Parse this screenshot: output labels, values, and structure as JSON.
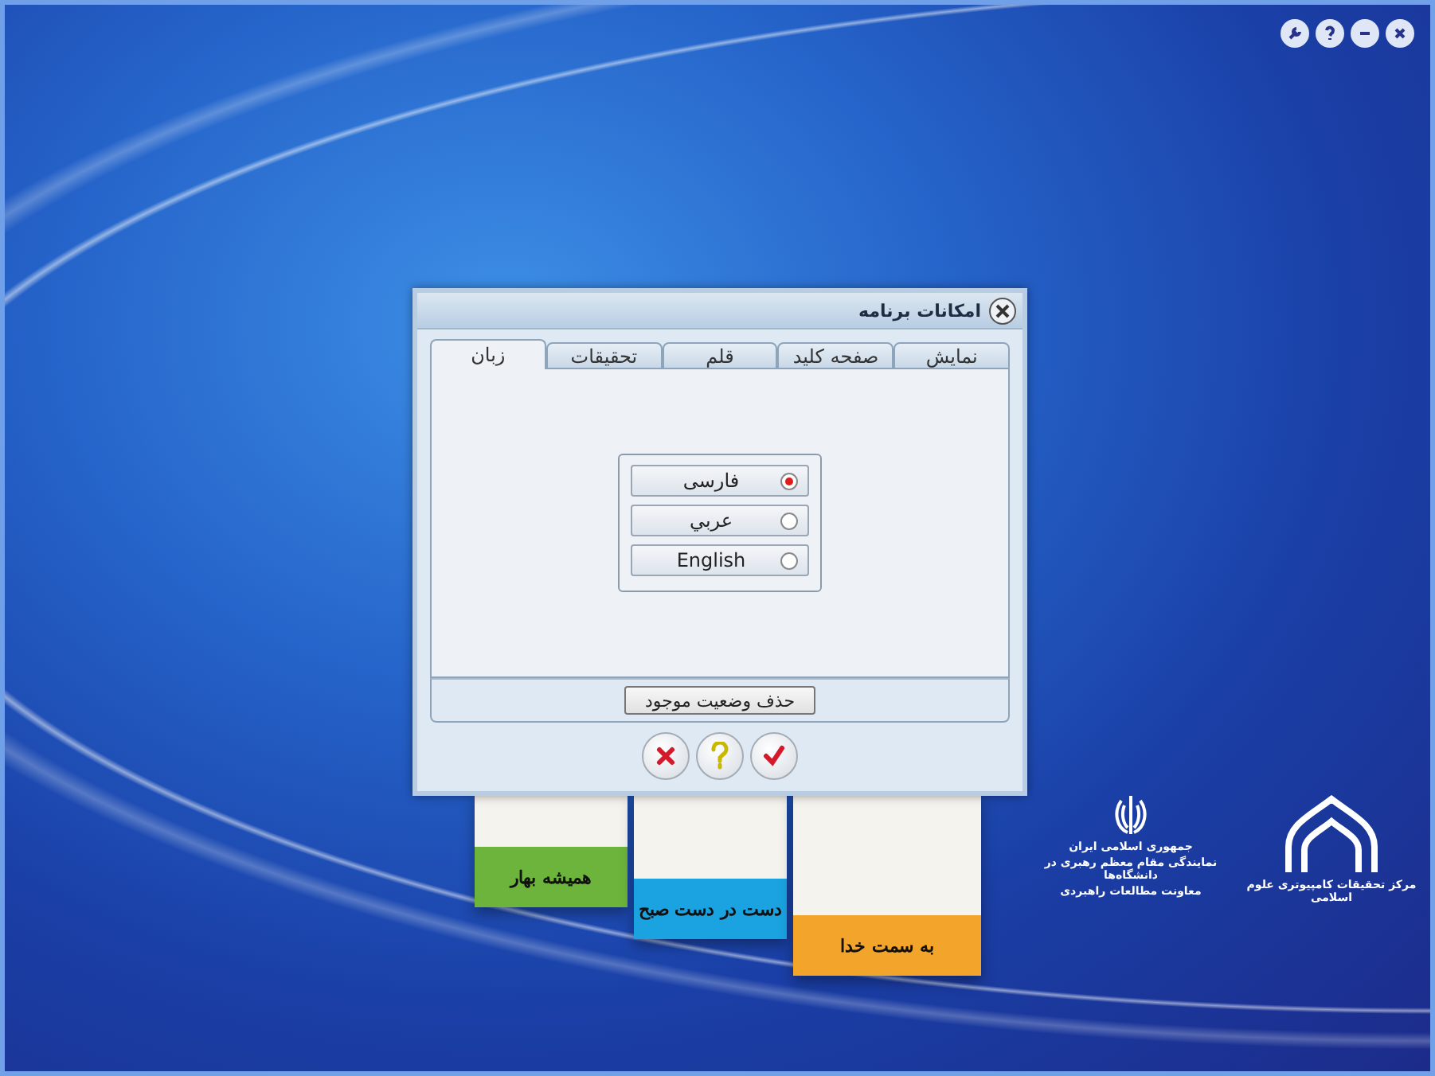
{
  "window": {
    "controls": [
      {
        "kind": "settings"
      },
      {
        "kind": "help"
      },
      {
        "kind": "minimize"
      },
      {
        "kind": "close"
      }
    ]
  },
  "dialog": {
    "title": "امکانات برنامه",
    "tabs": [
      {
        "label": "نمایش",
        "selected": false
      },
      {
        "label": "صفحه کلید",
        "selected": false
      },
      {
        "label": "قلم",
        "selected": false
      },
      {
        "label": "تحقیقات",
        "selected": false
      },
      {
        "label": "زبان",
        "selected": true
      }
    ],
    "languages": [
      {
        "label": "فارسی",
        "selected": true
      },
      {
        "label": "عربي",
        "selected": false
      },
      {
        "label": "English",
        "selected": false
      }
    ],
    "reset_button": "حذف وضعیت موجود",
    "actions": [
      {
        "kind": "cancel"
      },
      {
        "kind": "help"
      },
      {
        "kind": "ok"
      }
    ]
  },
  "books": [
    {
      "title": "همیشه بهار",
      "color": "#6cb43c"
    },
    {
      "title": "دست در دست صبح",
      "color": "#1aa3e0"
    },
    {
      "title": "به سمت خدا",
      "color": "#f2a52a"
    }
  ],
  "logos": [
    {
      "kind": "dome",
      "lines": [
        "مرکز تحقیقات کامپیوتری علوم اسلامی"
      ]
    },
    {
      "kind": "emblem",
      "lines": [
        "جمهوری اسلامی ایران",
        "نمایندگی مقام معظم رهبری در دانشگاه‌ها",
        "معاونت مطالعات راهبردی"
      ]
    }
  ]
}
